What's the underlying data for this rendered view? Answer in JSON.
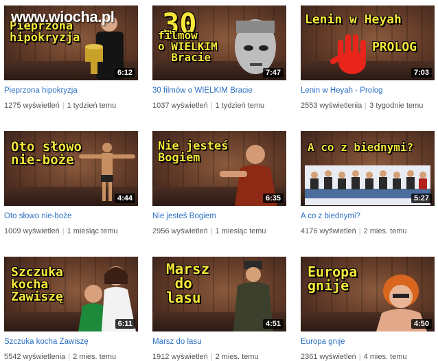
{
  "watermark": "www.wiocha.pl",
  "videos": [
    {
      "title": "Pieprzona hipokryzja",
      "thumb_text": "Pieprzona\nhipokryzja",
      "duration": "6:12",
      "views": "1275 wyświetleń",
      "age": "1 tydzień temu",
      "figure": "man-with-cup"
    },
    {
      "title": "30 filmów o WIELKIM Bracie",
      "thumb_text": "30",
      "thumb_text2": "filmów\no WIELKIM\n  Bracie",
      "duration": "7:47",
      "views": "1037 wyświetleń",
      "age": "1 tydzień temu",
      "figure": "cyborg-face"
    },
    {
      "title": "Lenin w Heyah - Prolog",
      "thumb_text": "Lenin w Heyah",
      "thumb_text2": "PROLOG",
      "duration": "7:03",
      "views": "2553 wyświetlenia",
      "age": "3 tygodnie temu",
      "figure": "red-hand"
    },
    {
      "title": "Oto słowo nie-boże",
      "thumb_text": "Oto słowo\nnie-boże",
      "duration": "4:44",
      "views": "1009 wyświetleń",
      "age": "1 miesiąc temu",
      "figure": "crucified-figure"
    },
    {
      "title": "Nie jesteś Bogiem",
      "thumb_text": "Nie jesteś\nBogiem",
      "duration": "6:35",
      "views": "2956 wyświetleń",
      "age": "1 miesiąc temu",
      "figure": "pointing-man"
    },
    {
      "title": "A co z biednymi?",
      "thumb_text": "A co z biednymi?",
      "duration": "5:27",
      "views": "4176 wyświetleń",
      "age": "2 mies. temu",
      "figure": "group-photo"
    },
    {
      "title": "Szczuka kocha Zawiszę",
      "thumb_text": "Szczuka\nkocha\nZawiszę",
      "duration": "6:11",
      "views": "5542 wyświetlenia",
      "age": "2 mies. temu",
      "figure": "couple"
    },
    {
      "title": "Marsz do lasu",
      "thumb_text": "Marsz\n do\nlasu",
      "duration": "4:51",
      "views": "1912 wyświetleń",
      "age": "2 mies. temu",
      "figure": "man-in-coat"
    },
    {
      "title": "Europa gnije",
      "thumb_text": "Europa\ngnije",
      "duration": "4:50",
      "views": "2361 wyświetleń",
      "age": "4 mies. temu",
      "figure": "red-hair-woman"
    }
  ],
  "colors": {
    "title_link": "#2b6fc2",
    "thumb_text": "#f7e73b",
    "meta": "#555555"
  }
}
